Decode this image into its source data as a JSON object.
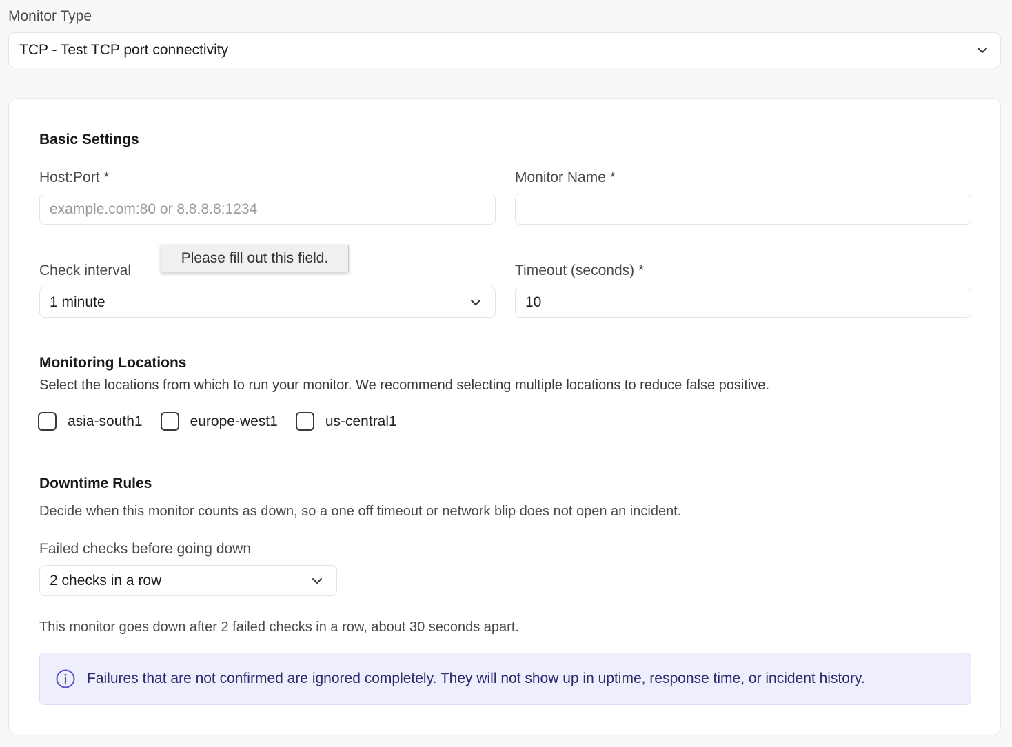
{
  "monitor_type": {
    "label": "Monitor Type",
    "value": "TCP - Test TCP port connectivity"
  },
  "basic_settings": {
    "title": "Basic Settings",
    "host_port": {
      "label": "Host:Port *",
      "placeholder": "example.com:80 or 8.8.8.8:1234",
      "value": ""
    },
    "monitor_name": {
      "label": "Monitor Name *",
      "value": ""
    },
    "check_interval": {
      "label": "Check interval",
      "value": "1 minute"
    },
    "timeout": {
      "label": "Timeout (seconds) *",
      "value": "10"
    },
    "tooltip": "Please fill out this field."
  },
  "locations": {
    "title": "Monitoring Locations",
    "description": "Select the locations from which to run your monitor. We recommend selecting multiple locations to reduce false positive.",
    "items": [
      {
        "label": "asia-south1",
        "checked": false
      },
      {
        "label": "europe-west1",
        "checked": false
      },
      {
        "label": "us-central1",
        "checked": false
      }
    ]
  },
  "downtime": {
    "title": "Downtime Rules",
    "description": "Decide when this monitor counts as down, so a one off timeout or network blip does not open an incident.",
    "failed_checks": {
      "label": "Failed checks before going down",
      "value": "2 checks in a row"
    },
    "summary": "This monitor goes down after 2 failed checks in a row, about 30 seconds apart.",
    "info": "Failures that are not confirmed are ignored completely. They will not show up in uptime, response time, or incident history."
  },
  "colors": {
    "info_bg": "#eeeefc",
    "info_accent": "#5b4fc7"
  }
}
